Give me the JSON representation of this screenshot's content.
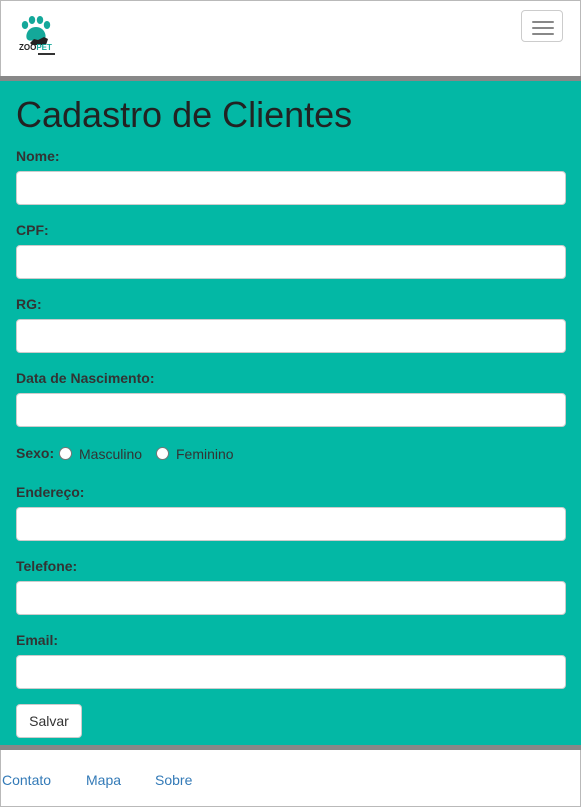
{
  "navbar": {
    "logo_text_zoo": "ZOO",
    "logo_text_pet": "PET",
    "logo_icon": "paw-icon",
    "toggle_icon": "hamburger-menu-icon"
  },
  "form": {
    "title": "Cadastro de Clientes",
    "fields": {
      "nome": {
        "label": "Nome:",
        "value": ""
      },
      "cpf": {
        "label": "CPF:",
        "value": ""
      },
      "rg": {
        "label": "RG:",
        "value": ""
      },
      "nascimento": {
        "label": "Data de Nascimento:",
        "value": ""
      },
      "endereco": {
        "label": "Endereço:",
        "value": ""
      },
      "telefone": {
        "label": "Telefone:",
        "value": ""
      },
      "email": {
        "label": "Email:",
        "value": ""
      }
    },
    "sexo": {
      "label": "Sexo:",
      "options": [
        "Masculino",
        "Feminino"
      ],
      "selected": null
    },
    "save_label": "Salvar"
  },
  "footer": {
    "links": [
      "Contato",
      "Mapa",
      "Sobre"
    ]
  },
  "colors": {
    "main_background": "#03b8a5",
    "divider": "#888888",
    "link": "#337ab7",
    "brand_accent": "#14a89a"
  }
}
